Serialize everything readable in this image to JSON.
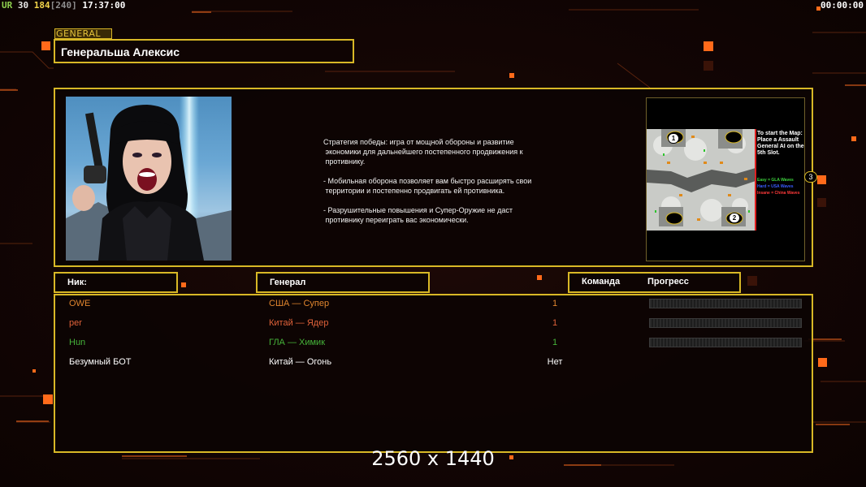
{
  "hud": {
    "ur_label": "UR",
    "fps": "30",
    "frame": "184",
    "frame_max": "[240]",
    "clock": "17:37:00",
    "timer": "00:00:00"
  },
  "general_tag": "GENERAL",
  "title": "Генеральша Алексис",
  "description": [
    "Стратегия победы: игра от мощной обороны и развитие\n экономики для дальнейшего постепенного продвижения к\n противнику.",
    "- Мобильная оборона позволяет вам быстро расширять свои\n территории и постепенно продвигать ей противника.",
    "- Разрушительные повышения и Супер-Оружие не даст\n противнику переиграть вас экономически."
  ],
  "minimap": {
    "info": "To start the Map: Place a Assault General AI on the 5th Slot.",
    "legend": [
      {
        "text": "Easy = GLA Waves",
        "color": "#3ed33e"
      },
      {
        "text": "Hard = USA Waves",
        "color": "#3a5cff"
      },
      {
        "text": "Insane = China Waves",
        "color": "#ff3a3a"
      }
    ],
    "start_positions": [
      "1",
      "2",
      "3"
    ]
  },
  "headers": {
    "nick": "Ник:",
    "general": "Генерал",
    "team": "Команда",
    "progress": "Прогресс"
  },
  "players": [
    {
      "nick": "OWE",
      "general": "США — Супер",
      "team": "1",
      "color": "#e0852e",
      "progress": 0
    },
    {
      "nick": "per",
      "general": "Китай — Ядер",
      "team": "1",
      "color": "#e0623a",
      "progress": 0
    },
    {
      "nick": "Hun",
      "general": "ГЛА — Химик",
      "team": "1",
      "color": "#46b43a",
      "progress": 0
    },
    {
      "nick": "Безумный БОТ",
      "general": "Китай — Огонь",
      "team": "Нет",
      "color": "#ffffff"
    }
  ],
  "resolution": "2560 x 1440"
}
